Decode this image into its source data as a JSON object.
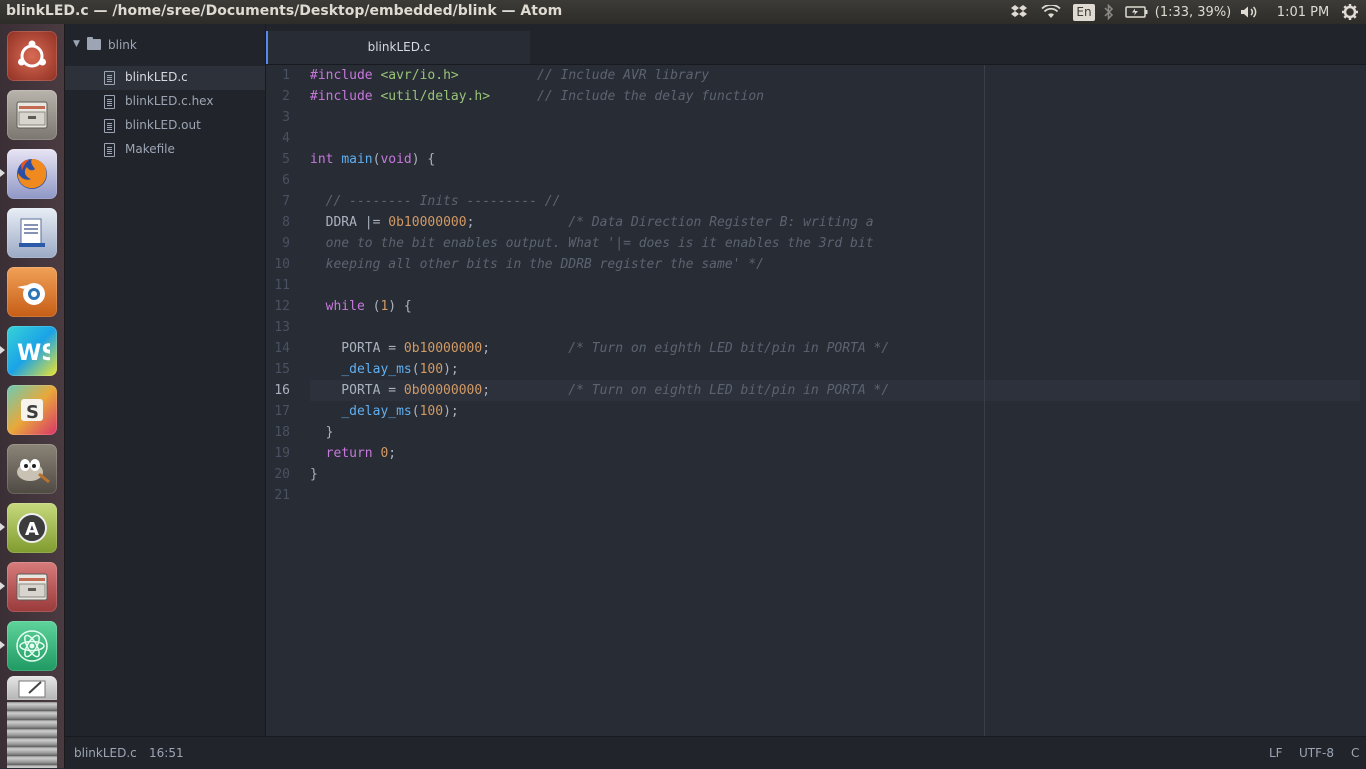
{
  "window": {
    "title": "blinkLED.c — /home/sree/Documents/Desktop/embedded/blink — Atom"
  },
  "panel": {
    "battery": "(1:33, 39%)",
    "keyboard_layout": "En",
    "clock": "1:01 PM",
    "icons": [
      "dropbox-icon",
      "wifi-icon",
      "keyboard-icon",
      "bluetooth-icon",
      "battery-icon",
      "volume-icon",
      "settings-gear-icon"
    ]
  },
  "launcher": {
    "apps": [
      "ubuntu-dash",
      "files",
      "firefox",
      "libreoffice-writer",
      "blender",
      "webstorm",
      "slack",
      "gimp",
      "software-updater",
      "files-2",
      "atom",
      "text-editor",
      "workspaces"
    ]
  },
  "tree": {
    "root": "blink",
    "files": [
      {
        "name": "blinkLED.c",
        "selected": true
      },
      {
        "name": "blinkLED.c.hex",
        "selected": false
      },
      {
        "name": "blinkLED.out",
        "selected": false
      },
      {
        "name": "Makefile",
        "selected": false
      }
    ]
  },
  "tabs": [
    {
      "label": "blinkLED.c",
      "active": true
    }
  ],
  "editor": {
    "current_line": 16,
    "line_numbers": [
      "1",
      "2",
      "3",
      "4",
      "5",
      "6",
      "7",
      "8",
      "9",
      "10",
      "11",
      "12",
      "13",
      "14",
      "15",
      "16",
      "17",
      "18",
      "19",
      "20",
      "21"
    ],
    "lines": [
      "#include <avr/io.h>          // Include AVR library",
      "#include <util/delay.h>      // Include the delay function",
      "",
      "",
      "int main(void) {",
      "",
      "  // -------- Inits --------- //",
      "  DDRA |= 0b10000000;            /* Data Direction Register B: writing a",
      "  one to the bit enables output. What '|= does is it enables the 3rd bit",
      "  keeping all other bits in the DDRB register the same' */",
      "",
      "  while (1) {",
      "",
      "    PORTA = 0b10000000;          /* Turn on eighth LED bit/pin in PORTA */",
      "    _delay_ms(100);",
      "    PORTA = 0b00000000;          /* Turn on eighth LED bit/pin in PORTA */",
      "    _delay_ms(100);",
      "  }",
      "  return 0;",
      "}",
      ""
    ]
  },
  "status": {
    "file": "blinkLED.c",
    "cursor": "16:51",
    "line_ending": "LF",
    "encoding": "UTF-8",
    "grammar": "C"
  },
  "colors": {
    "editor_bg": "#282c34",
    "panel_bg": "#21252b",
    "keyword": "#c678dd",
    "string": "#98c379",
    "comment": "#5c6370",
    "function": "#61afef",
    "number": "#d19a66",
    "accent": "#568af2"
  }
}
